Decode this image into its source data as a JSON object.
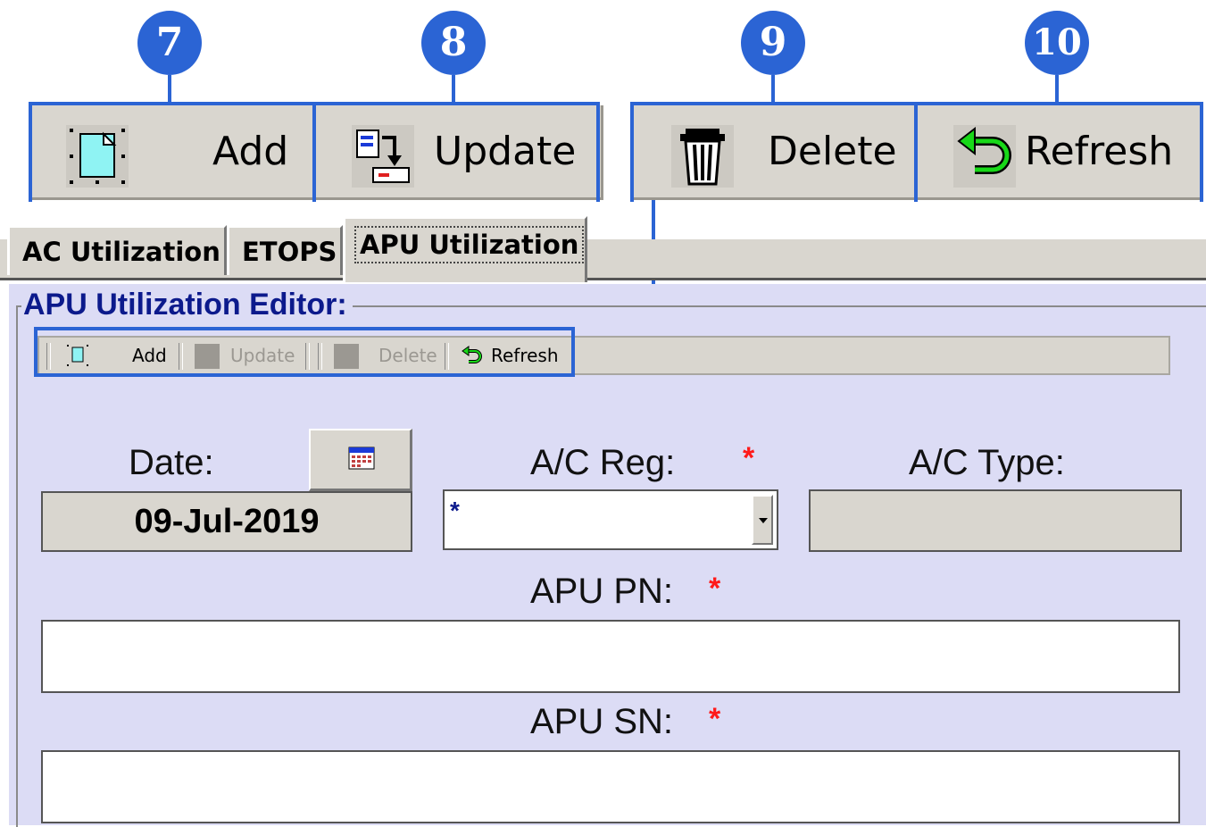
{
  "callouts": [
    "7",
    "8",
    "9",
    "10"
  ],
  "toolbar_large": {
    "add_label": "Add",
    "update_label": "Update",
    "delete_label": "Delete",
    "refresh_label": "Refresh"
  },
  "tabs": [
    {
      "label": "AC Utilization"
    },
    {
      "label": "ETOPS"
    },
    {
      "label": "APU Utilization"
    }
  ],
  "editor": {
    "title": "APU Utilization Editor:",
    "toolbar": {
      "add_label": "Add",
      "update_label": "Update",
      "delete_label": "Delete",
      "refresh_label": "Refresh"
    },
    "date": {
      "label": "Date:",
      "value": "09-Jul-2019"
    },
    "ac_reg": {
      "label": "A/C Reg:",
      "value": "*",
      "required_mark": "*"
    },
    "ac_type": {
      "label": "A/C Type:",
      "value": ""
    },
    "apu_pn": {
      "label": "APU PN:",
      "value": "",
      "required_mark": "*"
    },
    "apu_sn": {
      "label": "APU SN:",
      "value": "",
      "required_mark": "*"
    }
  },
  "colors": {
    "callout_blue": "#2b64d4",
    "panel_background": "#dcdcf5",
    "title_navy": "#0c1a8c",
    "required_red": "#ff1a1a"
  }
}
